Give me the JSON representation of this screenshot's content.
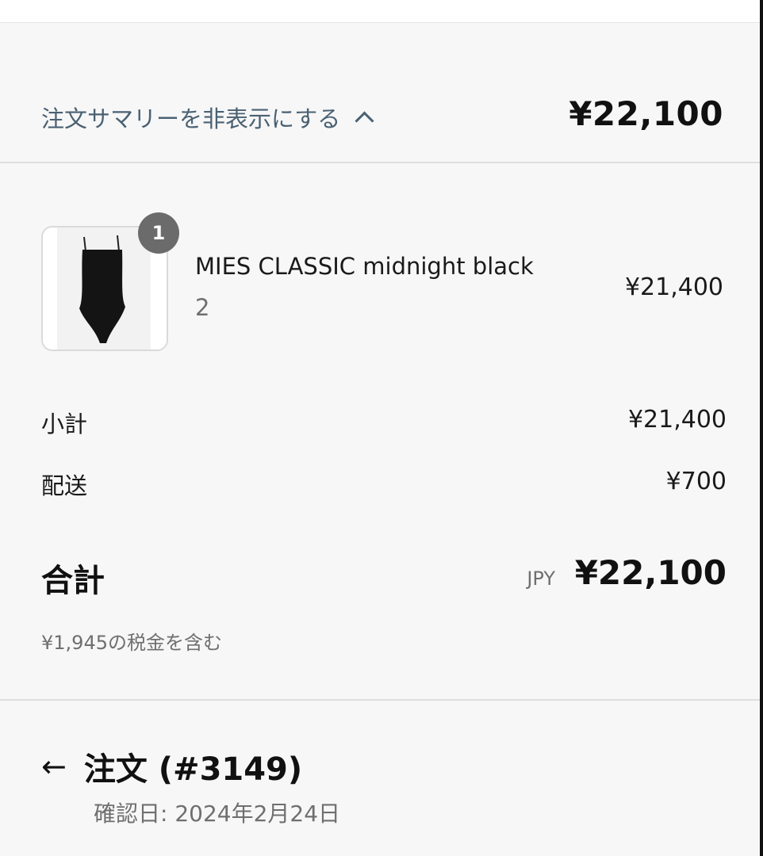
{
  "summary": {
    "toggle_label": "注文サマリーを非表示にする",
    "total": "¥22,100"
  },
  "line_item": {
    "quantity_badge": "1",
    "name": "MIES CLASSIC midnight black",
    "variant": "2",
    "price": "¥21,400"
  },
  "costs": {
    "subtotal_label": "小計",
    "subtotal_value": "¥21,400",
    "shipping_label": "配送",
    "shipping_value": "¥700",
    "total_label": "合計",
    "currency": "JPY",
    "total_value": "¥22,100",
    "tax_note": "¥1,945の税金を含む"
  },
  "order": {
    "title": "注文 (#3149)",
    "confirmed_date": "確認日: 2024年2月24日"
  },
  "icons": {
    "toggle": "chevron-up-icon",
    "back": "arrow-left-icon"
  },
  "colors": {
    "link": "#4a6173",
    "badge": "#6b6b6b",
    "background": "#f7f7f7"
  }
}
